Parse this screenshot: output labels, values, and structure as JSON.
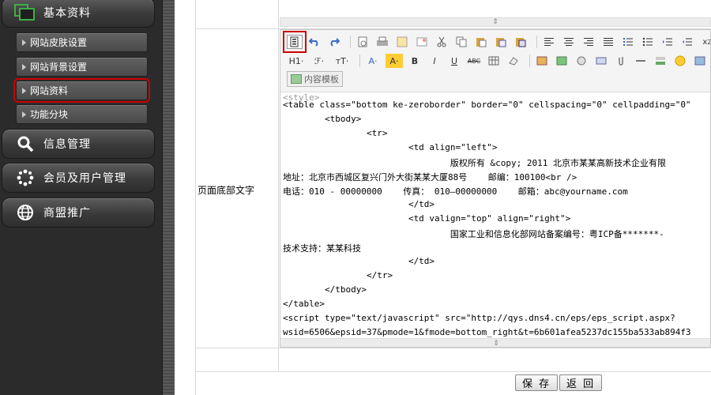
{
  "sidebar": {
    "categories": [
      {
        "label": "基本资料",
        "icon": "folder-icon"
      },
      {
        "label": "信息管理",
        "icon": "search-icon"
      },
      {
        "label": "会员及用户管理",
        "icon": "users-dots-icon"
      },
      {
        "label": "商盟推广",
        "icon": "globe-icon"
      }
    ],
    "subitems": [
      {
        "label": "网站皮肤设置"
      },
      {
        "label": "网站背景设置"
      },
      {
        "label": "网站资料",
        "selected": true
      },
      {
        "label": "功能分块"
      }
    ]
  },
  "form": {
    "field_label": "页面底部文字",
    "template_button": "内容模板",
    "save_button": "保 存",
    "back_button": "返 回"
  },
  "editor": {
    "code_lines": [
      "<table class=\"bottom ke-zeroborder\" border=\"0\" cellspacing=\"0\" cellpadding=\"0\"",
      "        <tbody>",
      "                <tr>",
      "                        <td align=\"left\">",
      "                                版权所有 &copy; 2011 北京市某某高新技术企业有限",
      "地址：北京市西城区复兴门外大街某某大厦88号    邮编：100100<br />",
      "电话：010 - 00000000    传真： 010—00000000    邮箱：abc@yourname.com",
      "                        </td>",
      "                        <td valign=\"top\" align=\"right\">",
      "                                国家工业和信息化部网站备案编号：粤ICP备*******-",
      "技术支持：某某科技",
      "                        </td>",
      "                </tr>",
      "        </tbody>",
      "</table>",
      "<script type=\"text/javascript\" src=\"http://qys.dns4.cn/eps/eps_script.aspx?",
      "wsid=6506&epsid=37&pmode=1&fmode=bottom_right&t=6b601afea5237dc155ba533ab894f3"
    ],
    "toolbar_row1": [
      "source-icon",
      "undo-icon",
      "redo-icon",
      "preview-icon",
      "print-icon",
      "template-icon",
      "code-icon",
      "cut-icon",
      "copy-icon",
      "paste-icon",
      "paste-text-icon",
      "paste-word-icon",
      "align-left-icon",
      "align-center-icon",
      "align-right-icon",
      "justify-icon",
      "ordered-list-icon",
      "unordered-list-icon",
      "indent-icon",
      "outdent-icon",
      "subscript-icon"
    ],
    "toolbar_row2_labels": [
      "H1·",
      "ℱ·",
      "тT·",
      "A·",
      "A·",
      "B",
      "I",
      "U",
      "ABC"
    ]
  },
  "colors": {
    "sidebar_bg": "#2b2b2b",
    "highlight": "#cc0000",
    "folder_green": "#3cb043"
  }
}
